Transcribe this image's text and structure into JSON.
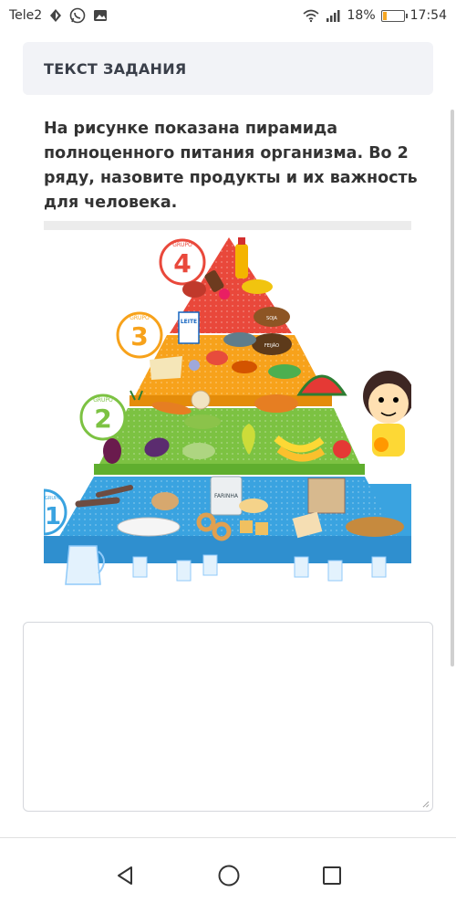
{
  "status_bar": {
    "carrier": "Tele2",
    "battery_percent": "18%",
    "time": "17:54",
    "battery_level": 0.18,
    "battery_color": "#f5a623"
  },
  "task": {
    "header": "ТЕКСТ ЗАДАНИЯ",
    "text": "На рисунке показана пирамида полноценного питания организма. Во 2 ряду, назовите продукты и их важность для человека."
  },
  "pyramid_image": {
    "group_labels": [
      "1",
      "2",
      "3",
      "4"
    ],
    "group_word": "GRUPO",
    "package_labels": [
      "LEITE",
      "FARINHA",
      "FEIJÃO",
      "SOJA"
    ],
    "tier_colors": [
      "#3aa3e0",
      "#7cc242",
      "#f7a21b",
      "#e9483b"
    ]
  },
  "answer": {
    "value": ""
  },
  "nav": {
    "back_icon": "triangle-back-icon",
    "home_icon": "circle-home-icon",
    "recents_icon": "square-recents-icon"
  }
}
